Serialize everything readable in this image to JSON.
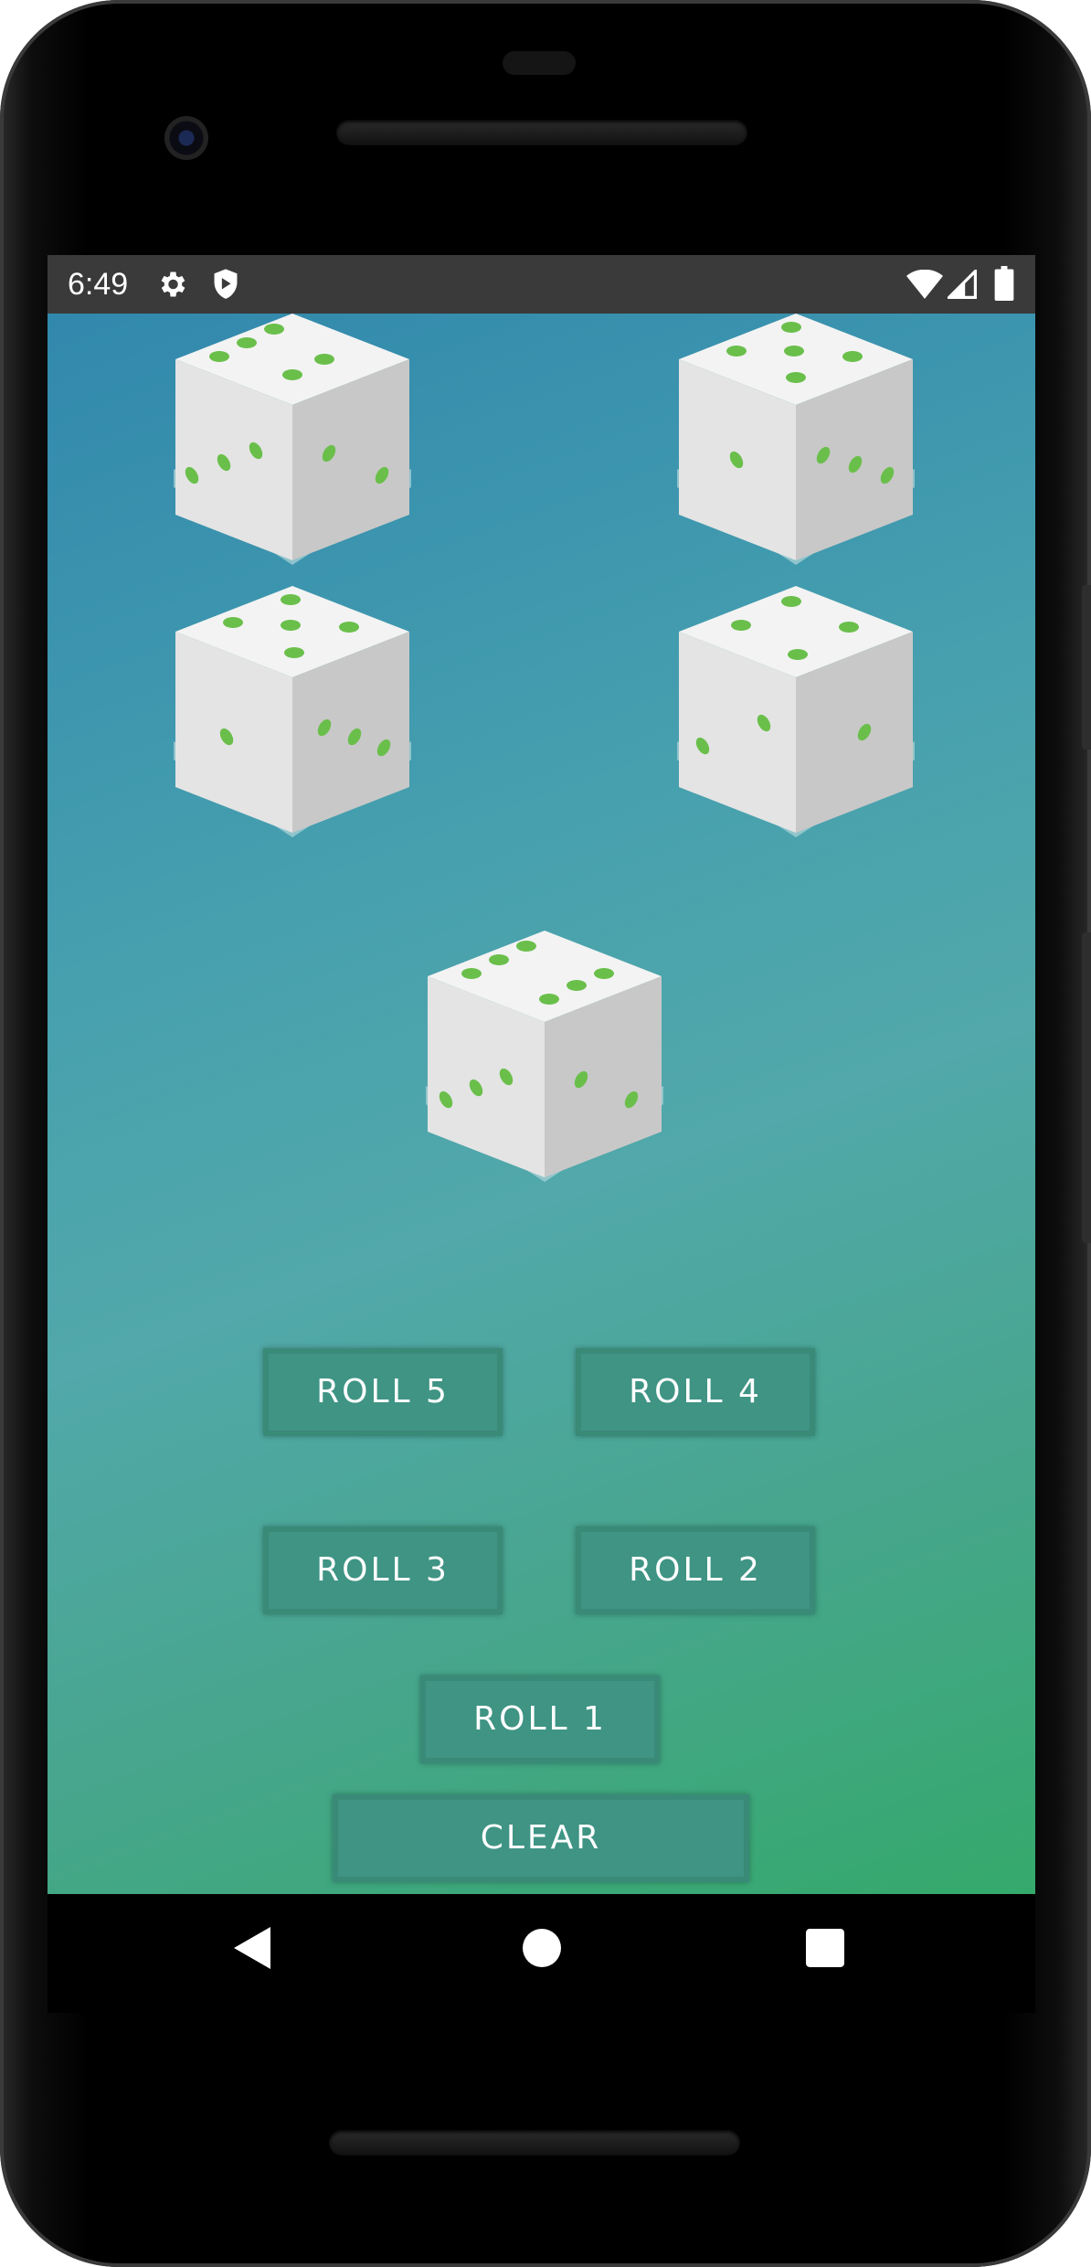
{
  "status_bar": {
    "time": "6:49",
    "left_icons": [
      "gear-icon",
      "shield-icon"
    ],
    "right_icons": [
      "wifi-icon",
      "signal-icon",
      "battery-icon"
    ]
  },
  "dice": [
    {
      "position_name": "top-left",
      "top_face": 5,
      "left_face": 3,
      "right_face": 2
    },
    {
      "position_name": "top-right",
      "top_face": 5,
      "left_face": 1,
      "right_face": 3
    },
    {
      "position_name": "middle-left",
      "top_face": 5,
      "left_face": 1,
      "right_face": 3
    },
    {
      "position_name": "middle-right",
      "top_face": 4,
      "left_face": 1,
      "right_face": 2
    },
    {
      "position_name": "center",
      "top_face": 6,
      "left_face": 3,
      "right_face": 2
    }
  ],
  "buttons": {
    "roll5": "ROLL 5",
    "roll4": "ROLL 4",
    "roll3": "ROLL 3",
    "roll2": "ROLL 2",
    "roll1": "ROLL 1",
    "clear": "CLEAR"
  },
  "nav_bar": {
    "icons": [
      "back-icon",
      "home-icon",
      "recents-icon"
    ]
  },
  "colors": {
    "background_top": "#3188ad",
    "background_bottom": "#35a96c",
    "button_fill": "#3f9484",
    "pip_green": "#6abf4b",
    "status_bar": "#3a3a3a"
  }
}
